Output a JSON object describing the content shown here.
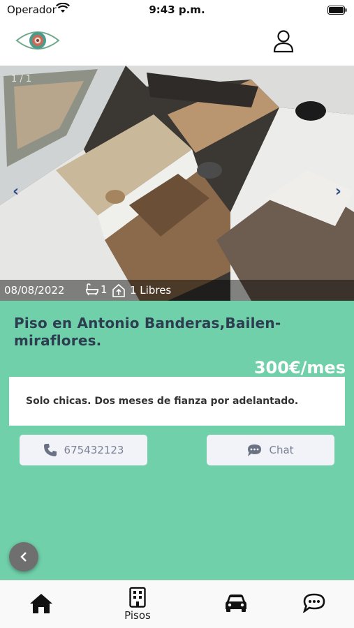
{
  "status_bar": {
    "carrier": "Operador",
    "time": "9:43 p.m."
  },
  "gallery": {
    "counter": "1 / 1",
    "date": "08/08/2022",
    "bathrooms": "1",
    "free_rooms": "1 Libres"
  },
  "listing": {
    "title": "Piso en Antonio Banderas,Bailen-miraflores.",
    "price": "300€/mes",
    "description": "Solo chicas. Dos meses de fianza por adelantado."
  },
  "actions": {
    "phone": "675432123",
    "chat": "Chat"
  },
  "tabs": {
    "pisos": "Pisos"
  },
  "colors": {
    "accent": "#70d0aa",
    "title_text": "#2c3e50",
    "button_bg": "#f1f3f8"
  }
}
